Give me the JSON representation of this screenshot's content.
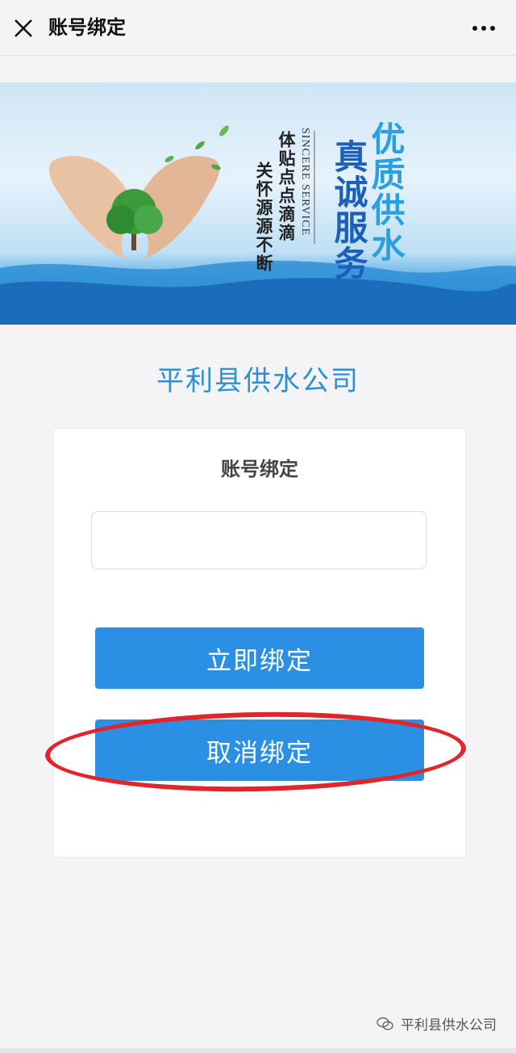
{
  "nav": {
    "title": "账号绑定",
    "close_icon": "close-icon",
    "more_icon": "more-dots-icon"
  },
  "banner": {
    "slogan_big_1": "优质供水",
    "slogan_big_2": "真诚服务",
    "slogan_en": "SINCERE SERVICE",
    "slogan_small_1": "体贴点点滴滴",
    "slogan_small_2": "关怀源源不断"
  },
  "company": {
    "title": "平利县供水公司"
  },
  "form": {
    "title": "账号绑定",
    "account_value": "",
    "account_placeholder": "",
    "bind_button": "立即绑定",
    "unbind_button": "取消绑定"
  },
  "footer": {
    "watermark": "平利县供水公司",
    "watermark_icon": "wechat-official-account-icon"
  },
  "colors": {
    "accent": "#2b8fe4",
    "title_blue": "#2d8fd7",
    "highlight_red": "#e0262b"
  }
}
